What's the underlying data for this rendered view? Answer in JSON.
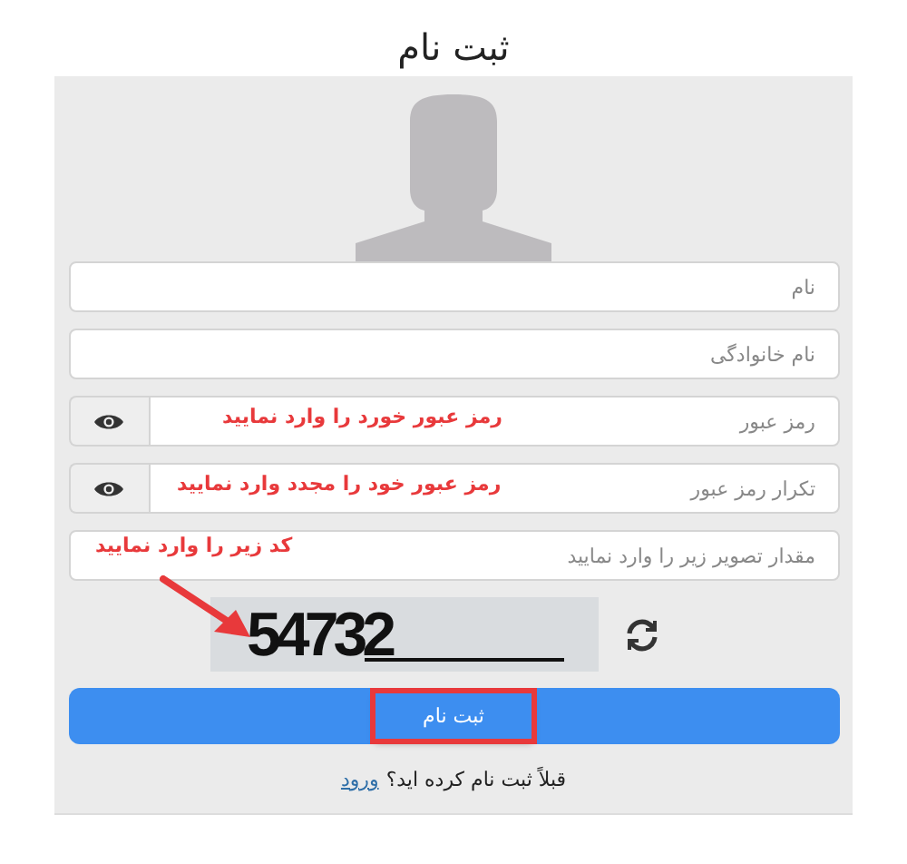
{
  "title": "ثبت نام",
  "fields": [
    {
      "kind": "text",
      "placeholder": "نام"
    },
    {
      "kind": "text",
      "placeholder": "نام خانوادگی"
    },
    {
      "kind": "password",
      "placeholder": "رمز عبور",
      "annotation": "رمز عبور خورد را وارد نمایید"
    },
    {
      "kind": "password",
      "placeholder": "تکرار رمز عبور",
      "annotation": "رمز عبور خود را مجدد وارد نمایید"
    },
    {
      "kind": "text",
      "placeholder": "مقدار تصویر زیر را وارد نمایید",
      "annotation": "کد زیر را وارد نمایید"
    }
  ],
  "captcha": {
    "code": "54732",
    "pointer_arrow": true
  },
  "submit": {
    "label": "ثبت نام",
    "highlighted": true
  },
  "footer": {
    "text": "قبلاً ثبت نام کرده اید؟",
    "link": "ورود"
  }
}
